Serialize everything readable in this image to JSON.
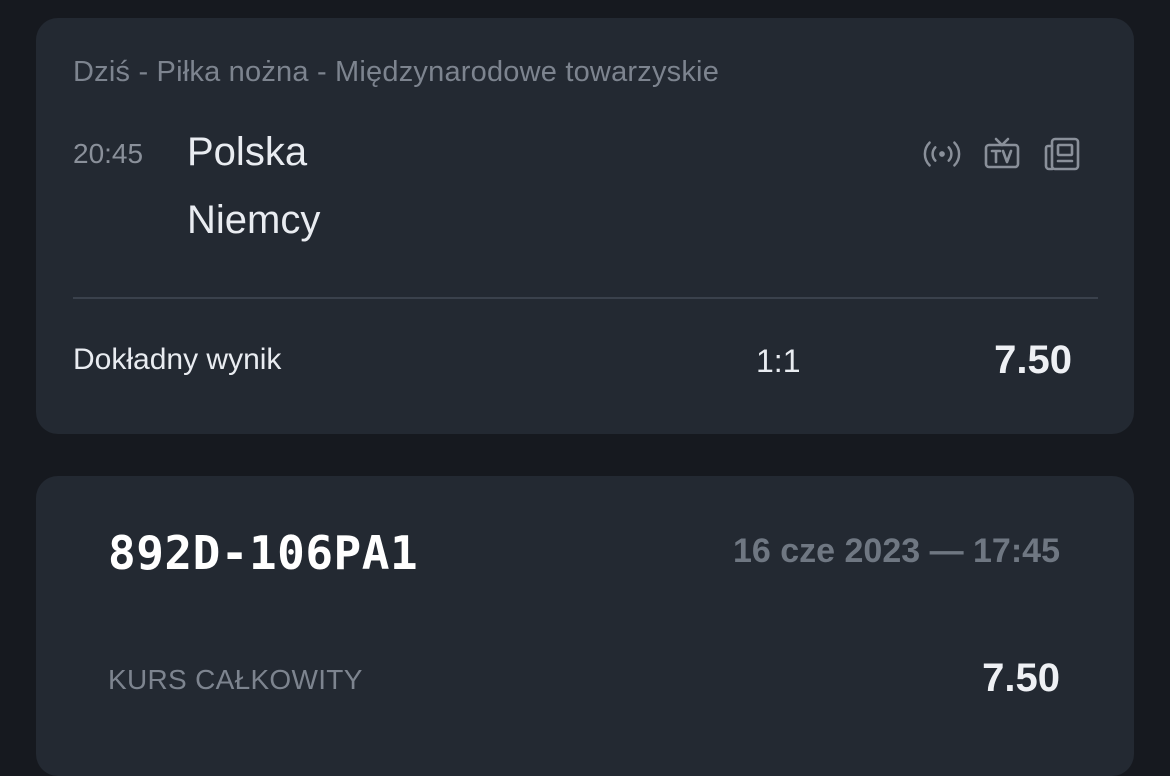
{
  "match_card": {
    "header": "Dziś - Piłka nożna - Międzynarodowe towarzyskie",
    "time": "20:45",
    "home_team": "Polska",
    "away_team": "Niemcy",
    "icons": [
      "live-broadcast-icon",
      "tv-icon",
      "statistics-icon"
    ],
    "market": "Dokładny wynik",
    "selection": "1:1",
    "odds": "7.50"
  },
  "slip_card": {
    "id": "892D-106PA1",
    "datetime": "16 cze 2023 — 17:45",
    "total_label": "KURS CAŁKOWITY",
    "total_odds": "7.50"
  },
  "colors": {
    "background": "#16191f",
    "card": "#232932",
    "text_primary": "#e9ecf1",
    "text_muted": "#7d848f",
    "icon": "#8a909a"
  }
}
